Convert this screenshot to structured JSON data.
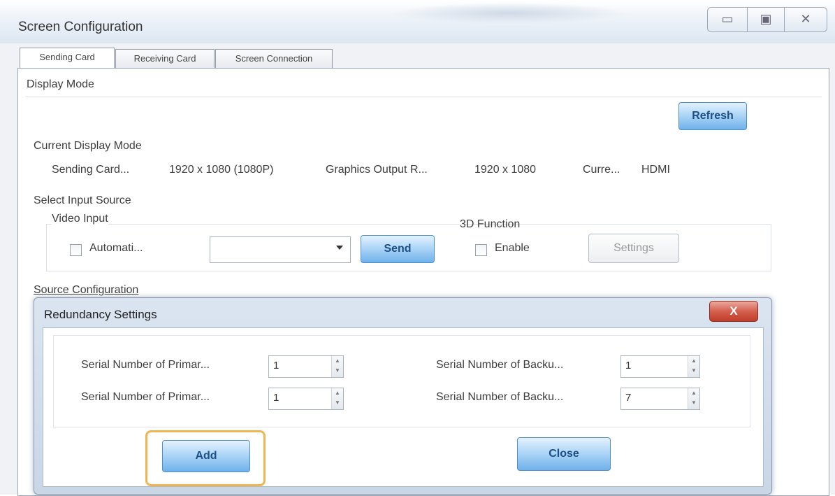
{
  "window": {
    "title": "Screen Configuration",
    "controls": {
      "minimize": "▭",
      "maximize": "▣",
      "close": "✕"
    }
  },
  "tabs": [
    {
      "label": "Sending Card",
      "active": true
    },
    {
      "label": "Receiving Card",
      "active": false
    },
    {
      "label": "Screen Connection",
      "active": false
    }
  ],
  "display_mode": {
    "label": "Display Mode",
    "refresh_label": "Refresh",
    "current_label": "Current Display Mode",
    "sending_card_label": "Sending Card...",
    "sending_card_value": "1920 x 1080 (1080P)",
    "graphics_output_label": "Graphics Output R...",
    "graphics_output_value": "1920 x 1080",
    "curr_label": "Curre...",
    "curr_value": "HDMI"
  },
  "input_source": {
    "label": "Select Input Source",
    "video_input_label": "Video Input",
    "automatic_label": "Automati...",
    "combo_value": "",
    "send_label": "Send",
    "function_3d_label": "3D Function",
    "enable_label": "Enable",
    "settings_label": "Settings"
  },
  "source_configuration": {
    "label": "Source Configuration"
  },
  "redundancy_dialog": {
    "title": "Redundancy Settings",
    "close_label": "X",
    "primary_label_1": "Serial Number of Primar...",
    "primary_value_1": "1",
    "primary_label_2": "Serial Number of Primar...",
    "primary_value_2": "1",
    "backup_label_1": "Serial Number of Backu...",
    "backup_value_1": "1",
    "backup_label_2": "Serial Number of Backu...",
    "backup_value_2": "7",
    "add_label": "Add",
    "close_button_label": "Close"
  },
  "colors": {
    "accent_blue": "#6fb1ea",
    "highlight_orange": "#f0b451",
    "close_red": "#c13d2a"
  }
}
